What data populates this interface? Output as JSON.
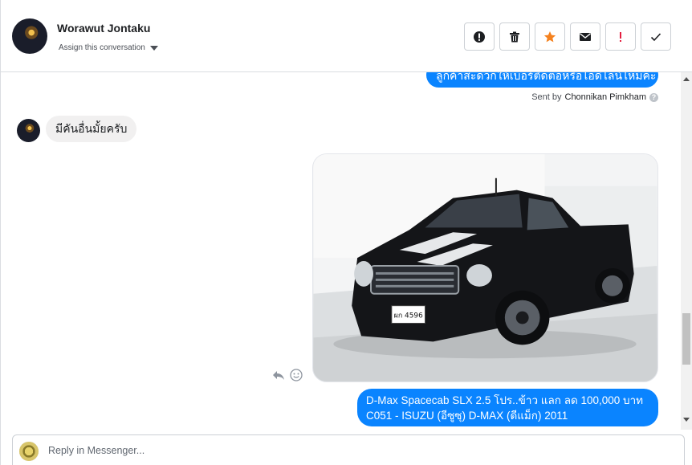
{
  "header": {
    "contact_name": "Worawut Jontaku",
    "assign_label": "Assign this conversation",
    "actions": [
      {
        "name": "mark-spam-button",
        "icon": "exclamation-circle-icon"
      },
      {
        "name": "delete-button",
        "icon": "trash-icon"
      },
      {
        "name": "star-button",
        "icon": "star-icon",
        "color": "#f5821f"
      },
      {
        "name": "mark-unread-button",
        "icon": "envelope-icon"
      },
      {
        "name": "follow-up-button",
        "icon": "exclamation-icon",
        "color": "#e41e3f"
      },
      {
        "name": "mark-done-button",
        "icon": "check-icon"
      }
    ]
  },
  "thread": {
    "messages": [
      {
        "direction": "outgoing",
        "text": "ลูกค้าสะดวกให้เบอร์ติดต่อหรือไอดีไลน์ไหมคะ"
      },
      {
        "direction": "incoming",
        "text": "มีคันอื่นมั้ยครับ"
      },
      {
        "direction": "outgoing",
        "type": "image",
        "icon": "pickup-truck-photo",
        "plate_text": "ผก 4596"
      },
      {
        "direction": "outgoing",
        "lines": [
          "D-Max Spacecab SLX 2.5 โปร..ข้าว แลก ลด 100,000 บาท",
          "C051 - ISUZU (อีซูซุ) D-MAX (ดีแม็ก) 2011"
        ]
      }
    ],
    "sent_by_prefix": "Sent by",
    "sent_by_name": "Chonnikan Pimkham",
    "reactions": [
      "reply-icon",
      "smiley-icon"
    ]
  },
  "composer": {
    "placeholder": "Reply in Messenger..."
  },
  "colors": {
    "outgoing_bubble": "#0a84ff",
    "incoming_bubble": "#f1f0f0",
    "star": "#f5821f",
    "follow_up": "#e41e3f"
  }
}
